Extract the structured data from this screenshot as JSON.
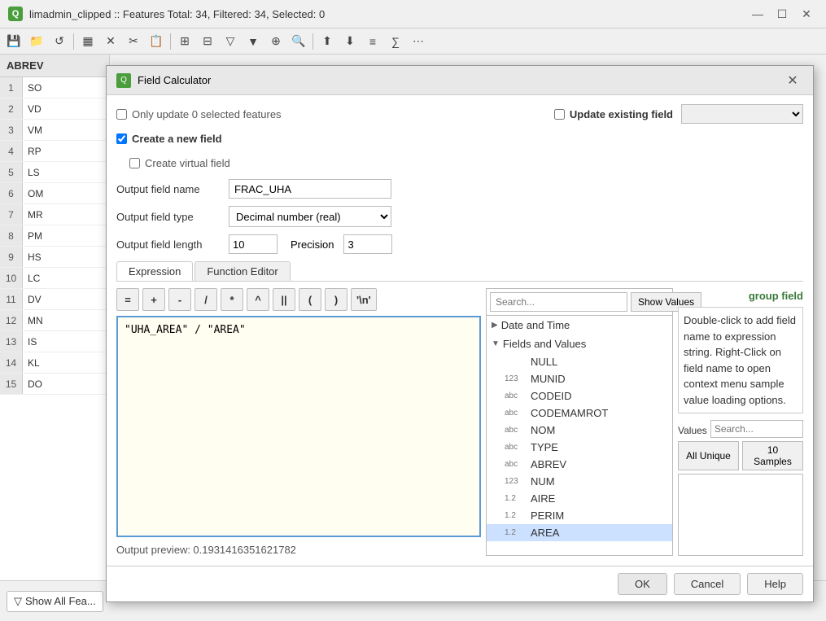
{
  "main_window": {
    "title": "limadmin_clipped :: Features Total: 34, Filtered: 34, Selected: 0"
  },
  "title_bar": {
    "icon_text": "Q",
    "controls": {
      "minimize": "—",
      "maximize": "☐",
      "close": "✕"
    }
  },
  "table": {
    "header": "ABREV",
    "rows": [
      {
        "num": "1",
        "val": "SO"
      },
      {
        "num": "2",
        "val": "VD"
      },
      {
        "num": "3",
        "val": "VM"
      },
      {
        "num": "4",
        "val": "RP"
      },
      {
        "num": "5",
        "val": "LS"
      },
      {
        "num": "6",
        "val": "OM"
      },
      {
        "num": "7",
        "val": "MR"
      },
      {
        "num": "8",
        "val": "PM"
      },
      {
        "num": "9",
        "val": "HS"
      },
      {
        "num": "10",
        "val": "LC"
      },
      {
        "num": "11",
        "val": "DV"
      },
      {
        "num": "12",
        "val": "MN"
      },
      {
        "num": "13",
        "val": "IS"
      },
      {
        "num": "14",
        "val": "KL"
      },
      {
        "num": "15",
        "val": "DO"
      }
    ]
  },
  "bottom_bar": {
    "show_all_label": "Show All Fea..."
  },
  "dialog": {
    "title": "Field Calculator",
    "icon_text": "Q",
    "close_btn": "✕",
    "only_update_label": "Only update 0 selected features",
    "create_new_field_label": "Create a new field",
    "create_virtual_label": "Create virtual field",
    "update_existing_label": "Update existing field",
    "output_field_name_label": "Output field name",
    "output_field_name_value": "FRAC_UHA",
    "output_field_type_label": "Output field type",
    "output_field_type_value": "Decimal number (real)",
    "output_field_length_label": "Output field length",
    "output_field_length_value": "10",
    "precision_label": "Precision",
    "precision_value": "3",
    "tabs": [
      {
        "id": "expression",
        "label": "Expression",
        "active": true
      },
      {
        "id": "function_editor",
        "label": "Function Editor",
        "active": false
      }
    ],
    "calc_buttons": [
      "=",
      "+",
      "-",
      "/",
      "*",
      "^",
      "||",
      "(",
      ")",
      "'\\n'"
    ],
    "expression_text": "\"UHA_AREA\" / \"AREA\"",
    "output_preview_label": "Output preview:",
    "output_preview_value": "0.1931416351621782",
    "search_placeholder": "Search...",
    "show_values_btn": "Show Values",
    "func_tree": {
      "groups": [
        {
          "id": "date_time",
          "label": "Date and Time",
          "expanded": false,
          "arrow": "▶"
        },
        {
          "id": "fields_values",
          "label": "Fields and Values",
          "expanded": true,
          "arrow": "▼",
          "items": [
            {
              "type": "",
              "name": "NULL"
            },
            {
              "type": "123",
              "name": "MUNID"
            },
            {
              "type": "abc",
              "name": "CODEID"
            },
            {
              "type": "abc",
              "name": "CODEMAMROT"
            },
            {
              "type": "abc",
              "name": "NOM"
            },
            {
              "type": "abc",
              "name": "TYPE"
            },
            {
              "type": "abc",
              "name": "ABREV"
            },
            {
              "type": "123",
              "name": "NUM"
            },
            {
              "type": "1.2",
              "name": "AIRE"
            },
            {
              "type": "1.2",
              "name": "PERIM"
            },
            {
              "type": "1.2",
              "name": "AREA",
              "selected": true
            }
          ]
        }
      ]
    },
    "group_field_label": "group field",
    "group_field_desc": "Double-click to add field name to expression string.\nRight-Click on field name to open context menu sample value loading options.",
    "values_label": "Values",
    "values_search_placeholder": "Search...",
    "all_unique_btn": "All Unique",
    "ten_samples_btn": "10 Samples",
    "footer": {
      "ok": "OK",
      "cancel": "Cancel",
      "help": "Help"
    }
  }
}
